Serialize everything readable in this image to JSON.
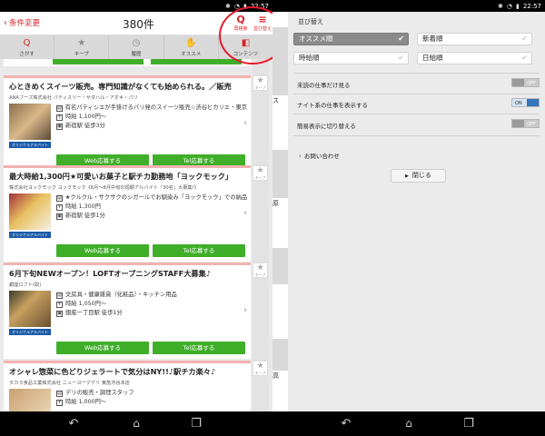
{
  "left": {
    "status_time": "22:57",
    "header": {
      "back_label": "条件変更",
      "count": "380件",
      "search_label": "再検索",
      "sort_label": "並び替え"
    },
    "tabs": [
      {
        "icon": "search-q-icon",
        "label": "さがす"
      },
      {
        "icon": "star-icon",
        "label": "キープ"
      },
      {
        "icon": "clock-icon",
        "label": "履歴"
      },
      {
        "icon": "thumbs-up-icon",
        "label": "オススメ"
      },
      {
        "icon": "contents-icon",
        "label": "コンテンツ"
      }
    ],
    "keep_label": "キープ",
    "jobs": [
      {
        "title": "心ときめくスイーツ販売。専門知識がなくても始められる。／販売",
        "company": "ANAフーズ株式会社 パティスリー・サダハル・アオキ・パリ",
        "desc": "有名パティシエが手掛けるパリ発のスイーツ販売☆渋谷ヒカリエ・東京...",
        "wage": "時給 1,100円～",
        "station": "新宿駅 徒歩3分",
        "badge": "オリジナルアルバイト",
        "web_btn": "Web応募する",
        "tel_btn": "Tel応募する"
      },
      {
        "title": "最大時給1,300円★可愛いお菓子と駅チカ勤務地「ヨックモック」",
        "company": "株式会社ヨックモック ヨックモック《6月～8月中旬の短期アルバイト『30名』大募集!》",
        "desc": "★クルクル・サクサクのシガールでお馴染み「ヨックモック」での納品...",
        "wage": "時給 1,300円",
        "station": "新宿駅 徒歩1分",
        "badge": "オリジナルアルバイト",
        "web_btn": "Web応募する",
        "tel_btn": "Tel応募する"
      },
      {
        "title": "6月下旬NEWオープン！LOFTオープニングSTAFF大募集♪",
        "company": "銀座ロフト(取)",
        "desc": "文房具・健康雑貨（化粧品）・キッチン用品",
        "wage": "時給 1,050円～",
        "station": "銀座一丁目駅 徒歩1分",
        "badge": "オリジナルアルバイト",
        "web_btn": "Web応募する",
        "tel_btn": "Tel応募する"
      },
      {
        "title": "オシャレ惣菜に色どりジェラートで気分はNY!!♪駅チカ楽々♪",
        "company": "タカラ食品工業株式会社 ニューヨークデリ 東急渋谷本店",
        "desc": "デリの販売・調理スタッフ",
        "wage": "時給 1,000円～",
        "station": "",
        "badge": "",
        "web_btn": "",
        "tel_btn": ""
      }
    ]
  },
  "right": {
    "status_time": "22:57",
    "title": "並び替え",
    "sort_options": [
      {
        "label": "オススメ順",
        "selected": true
      },
      {
        "label": "新着順",
        "selected": false
      },
      {
        "label": "時給順",
        "selected": false
      },
      {
        "label": "日給順",
        "selected": false
      }
    ],
    "toggles": [
      {
        "label": "未読の仕事だけ見る",
        "state": "OFF"
      },
      {
        "label": "ナイト系の仕事を表示する",
        "state": "ON"
      },
      {
        "label": "簡易表示に切り替える",
        "state": "OFF"
      }
    ],
    "contact_label": "お問い合わせ",
    "close_label": "閉じる",
    "peek_text_1": "ス",
    "peek_text_2": "原",
    "peek_text_3": "高"
  },
  "colors": {
    "brand_red": "#d8232a",
    "apply_green": "#3fae29",
    "toggle_on": "#3575b8",
    "annotation_circle": "#e8182a"
  }
}
